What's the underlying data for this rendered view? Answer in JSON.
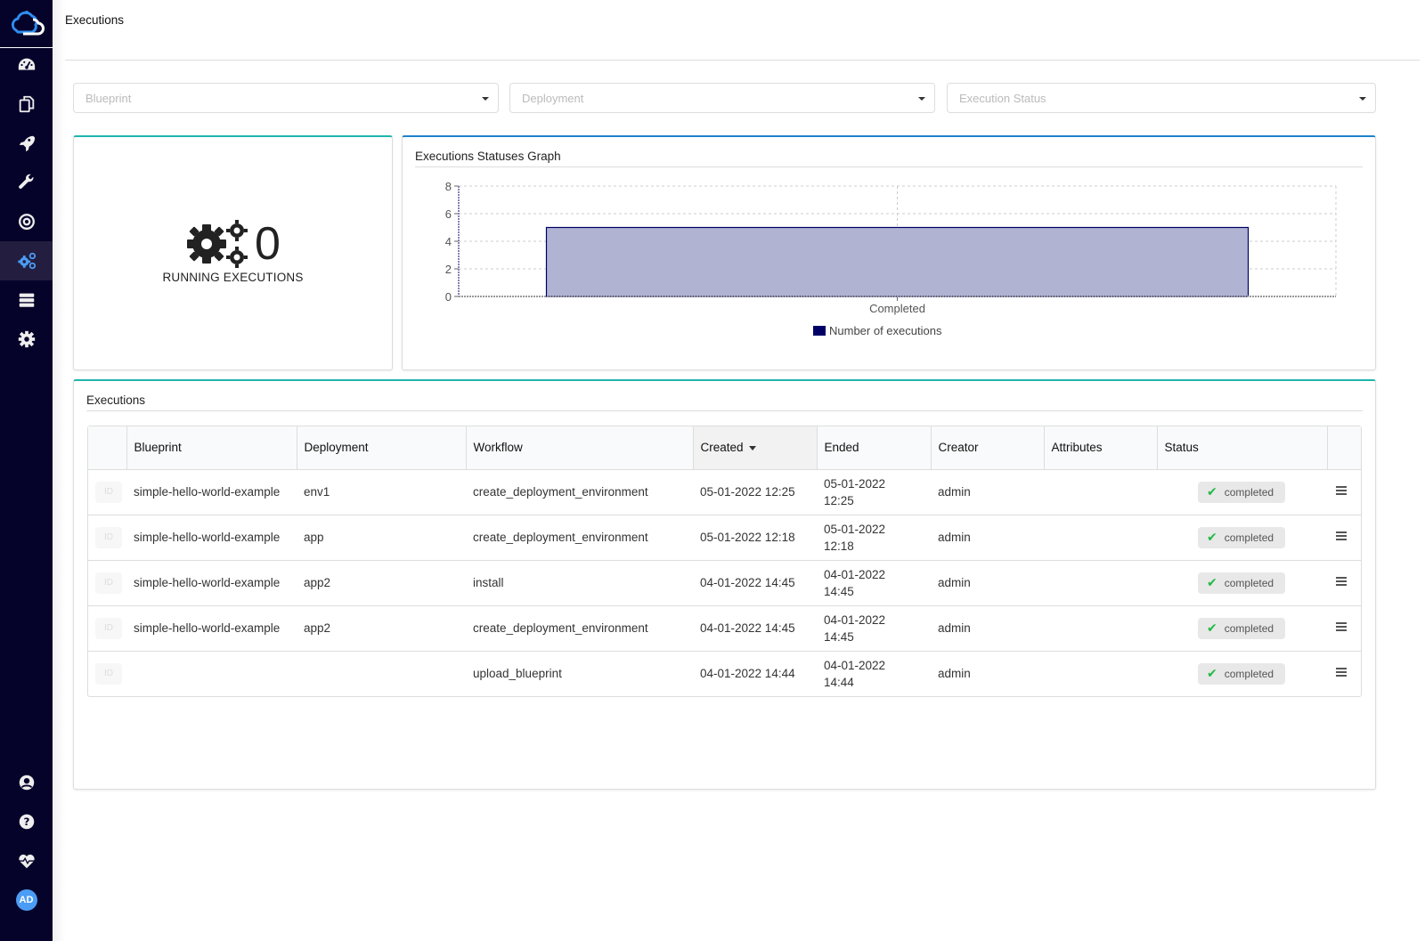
{
  "page": {
    "title": "Executions"
  },
  "sidebar": {
    "items": [
      {
        "name": "dashboard",
        "icon": "dashboard-icon"
      },
      {
        "name": "blueprints",
        "icon": "copy-icon"
      },
      {
        "name": "deployments",
        "icon": "rocket-icon"
      },
      {
        "name": "plugins",
        "icon": "wrench-icon"
      },
      {
        "name": "sites",
        "icon": "target-icon"
      },
      {
        "name": "executions",
        "icon": "cogs-icon",
        "active": true
      },
      {
        "name": "system-resources",
        "icon": "server-icon"
      },
      {
        "name": "settings",
        "icon": "gear-icon"
      }
    ],
    "bottom": [
      {
        "name": "user",
        "icon": "user-circle-icon"
      },
      {
        "name": "help",
        "icon": "question-circle-icon"
      },
      {
        "name": "health",
        "icon": "heartbeat-icon"
      }
    ],
    "avatar_initials": "AD"
  },
  "filters": {
    "blueprint_placeholder": "Blueprint",
    "deployment_placeholder": "Deployment",
    "status_placeholder": "Execution Status"
  },
  "running": {
    "count": "0",
    "label": "RUNNING EXECUTIONS"
  },
  "graph": {
    "title": "Executions Statuses Graph"
  },
  "chart_data": {
    "type": "bar",
    "title": "Executions Statuses Graph",
    "categories": [
      "Completed"
    ],
    "series": [
      {
        "name": "Number of executions",
        "values": [
          5
        ]
      }
    ],
    "yticks": [
      "0",
      "2",
      "4",
      "6",
      "8"
    ],
    "ylim": [
      0,
      8
    ],
    "grid": true,
    "legend": "bottom-center",
    "colors": {
      "bar_fill": "#b0b3d2",
      "bar_stroke": "#000066",
      "legend": "#000066"
    }
  },
  "executions": {
    "title": "Executions",
    "columns": [
      "",
      "Blueprint",
      "Deployment",
      "Workflow",
      "Created",
      "Ended",
      "Creator",
      "Attributes",
      "Status",
      ""
    ],
    "sorted_column": "Created",
    "id_label": "ID",
    "rows": [
      {
        "blueprint": "simple-hello-world-example",
        "deployment": "env1",
        "workflow": "create_deployment_environment",
        "created": "05-01-2022 12:25",
        "ended_date": "05-01-2022",
        "ended_time": "12:25",
        "creator": "admin",
        "attributes": "",
        "status": "completed"
      },
      {
        "blueprint": "simple-hello-world-example",
        "deployment": "app",
        "workflow": "create_deployment_environment",
        "created": "05-01-2022 12:18",
        "ended_date": "05-01-2022",
        "ended_time": "12:18",
        "creator": "admin",
        "attributes": "",
        "status": "completed"
      },
      {
        "blueprint": "simple-hello-world-example",
        "deployment": "app2",
        "workflow": "install",
        "created": "04-01-2022 14:45",
        "ended_date": "04-01-2022",
        "ended_time": "14:45",
        "creator": "admin",
        "attributes": "",
        "status": "completed"
      },
      {
        "blueprint": "simple-hello-world-example",
        "deployment": "app2",
        "workflow": "create_deployment_environment",
        "created": "04-01-2022 14:45",
        "ended_date": "04-01-2022",
        "ended_time": "14:45",
        "creator": "admin",
        "attributes": "",
        "status": "completed"
      },
      {
        "blueprint": "",
        "deployment": "",
        "workflow": "upload_blueprint",
        "created": "04-01-2022 14:44",
        "ended_date": "04-01-2022",
        "ended_time": "14:44",
        "creator": "admin",
        "attributes": "",
        "status": "completed"
      }
    ]
  }
}
